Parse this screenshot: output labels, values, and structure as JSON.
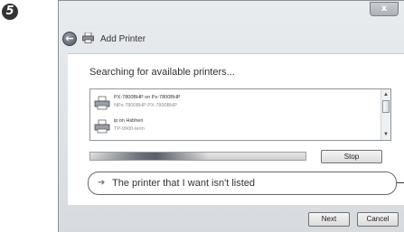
{
  "step": {
    "number": "5"
  },
  "window": {
    "close_label": "x"
  },
  "header": {
    "title": "Add Printer"
  },
  "content": {
    "searching_text": "Searching for available printers...",
    "printers": [
      {
        "name": "PX-7800BHP on Px-7800BHP",
        "detail": "NPx-7800BHP PX-7800BHP"
      },
      {
        "name": "ip on Hsbhen",
        "detail": "TP-9900-term"
      }
    ],
    "progress_fraction": 0.55,
    "stop_label": "Stop",
    "not_listed_label": "The printer that I want isn't listed"
  },
  "footer": {
    "next_label": "Next",
    "cancel_label": "Cancel"
  },
  "colors": {
    "window_bg": "#e0e3e7",
    "content_bg": "#ffffff",
    "border": "#707070"
  },
  "icons": {
    "back": "back-arrow-icon",
    "printer": "printer-icon",
    "arrow": "link-arrow-icon"
  }
}
